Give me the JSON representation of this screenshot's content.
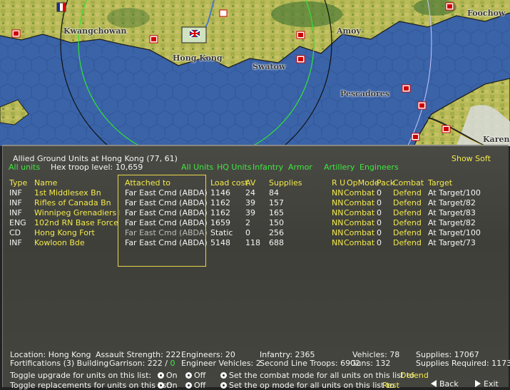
{
  "map": {
    "labels": {
      "kwangchowan": "Kwangchowan",
      "hongkong": "Hong Kong",
      "swatow": "Swatow",
      "amoy": "Amoy",
      "pescadores": "Pescadores",
      "foochow": "Foochow",
      "karen": "Karen"
    }
  },
  "panel": {
    "title": "Allied Ground Units at Hong Kong  (77, 61)",
    "show_soft": "Show Soft",
    "all_units": "All units",
    "hex_troop": "Hex troop level: 10,659",
    "filters": {
      "all": "All Units",
      "hq": "HQ Units",
      "inf": "Infantry",
      "armor": "Armor",
      "art": "Artillery",
      "eng": "Engineers"
    },
    "columns": {
      "type": "Type",
      "name": "Name",
      "attached": "Attached to",
      "load": "Load cost",
      "av": "AV",
      "supplies": "Supplies",
      "ru": "R U",
      "opmode": "OpMode",
      "pack": "Pack",
      "combat": "Combat",
      "target": "Target"
    },
    "rows": [
      {
        "type": "INF",
        "name": "1st Middlesex Bn",
        "attached": "Far East Cmd (ABDA)",
        "load": "1146",
        "av": "24",
        "supplies": "84",
        "ru": "NN",
        "opmode": "Combat",
        "pack": "0",
        "combat": "Defend",
        "target": "At Target/100"
      },
      {
        "type": "INF",
        "name": "Rifles of Canada Bn",
        "attached": "Far East Cmd (ABDA)",
        "load": "1162",
        "av": "39",
        "supplies": "157",
        "ru": "NN",
        "opmode": "Combat",
        "pack": "0",
        "combat": "Defend",
        "target": "At Target/82"
      },
      {
        "type": "INF",
        "name": "Winnipeg Grenadiers Bn",
        "attached": "Far East Cmd (ABDA)",
        "load": "1162",
        "av": "39",
        "supplies": "165",
        "ru": "NN",
        "opmode": "Combat",
        "pack": "0",
        "combat": "Defend",
        "target": "At Target/83"
      },
      {
        "type": "ENG",
        "name": "102nd RN Base Force",
        "attached": "Far East Cmd (ABDA)",
        "load": "1659",
        "av": "2",
        "supplies": "150",
        "ru": "NN",
        "opmode": "Combat",
        "pack": "0",
        "combat": "Defend",
        "target": "At Target/82"
      },
      {
        "type": "CD",
        "name": "Hong Kong Fort",
        "attached": "Far East Cmd (ABDA)",
        "load": "Static",
        "av": "0",
        "supplies": "256",
        "ru": "NN",
        "opmode": "Combat",
        "pack": "0",
        "combat": "Defend",
        "target": "At Target/100"
      },
      {
        "type": "INF",
        "name": "Kowloon Bde",
        "attached": "Far East Cmd (ABDA)",
        "load": "5148",
        "av": "118",
        "supplies": "688",
        "ru": "NN",
        "opmode": "Combat",
        "pack": "0",
        "combat": "Defend",
        "target": "At Target/73"
      }
    ],
    "summary": {
      "location": "Location: Hong Kong",
      "assault": "Assault Strength: 222",
      "engineers": "Engineers:  20",
      "infantry": "Infantry: 2365",
      "vehicles": "Vehicles: 78",
      "supplies": "Supplies:  17067",
      "fortifications": "Fortifications (3) Building",
      "garrison_label": "Garrison:  222  / ",
      "garrison_val": "0",
      "eng_vehicles": "Engineer Vehicles:  2",
      "second_line": "Second Line Troops: 6902",
      "guns": "Guns: 132",
      "supplies_req": "Supplies Required:   1173"
    },
    "controls": {
      "toggle_upgrade": "Toggle upgrade for units on this list:",
      "toggle_replace": "Toggle replacements for units on this list:",
      "on": "On",
      "off": "Off",
      "set_combat": "Set the combat mode for all units on this list to",
      "combat_val": "Defend",
      "set_op": "Set the op mode for all units on this list to",
      "op_val": "Rest",
      "back": "Back",
      "exit": "Exit"
    }
  },
  "colors": {
    "yellow": "#f2ea4a",
    "green": "#3ee83e",
    "sea": "#3a63a8",
    "land": "#b7b85a"
  }
}
